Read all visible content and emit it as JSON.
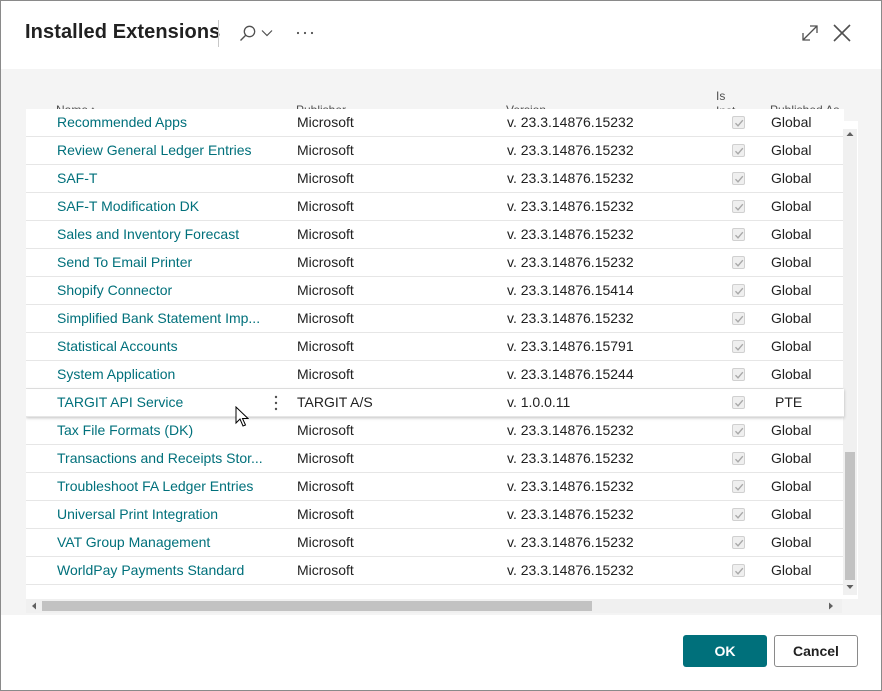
{
  "dialog": {
    "title": "Installed Extensions",
    "ok_label": "OK",
    "cancel_label": "Cancel"
  },
  "columns": {
    "name": "Name",
    "name_sort": "↑",
    "publisher": "Publisher",
    "version": "Version",
    "is_installed_line1": "Is",
    "is_installed_line2": "Inst...",
    "published_as": "Published As"
  },
  "rows": [
    {
      "name": "Recommended Apps",
      "publisher": "Microsoft",
      "version": "v. 23.3.14876.15232",
      "installed": true,
      "published_as": "Global"
    },
    {
      "name": "Review General Ledger Entries",
      "publisher": "Microsoft",
      "version": "v. 23.3.14876.15232",
      "installed": true,
      "published_as": "Global"
    },
    {
      "name": "SAF-T",
      "publisher": "Microsoft",
      "version": "v. 23.3.14876.15232",
      "installed": true,
      "published_as": "Global"
    },
    {
      "name": "SAF-T Modification DK",
      "publisher": "Microsoft",
      "version": "v. 23.3.14876.15232",
      "installed": true,
      "published_as": "Global"
    },
    {
      "name": "Sales and Inventory Forecast",
      "publisher": "Microsoft",
      "version": "v. 23.3.14876.15232",
      "installed": true,
      "published_as": "Global"
    },
    {
      "name": "Send To Email Printer",
      "publisher": "Microsoft",
      "version": "v. 23.3.14876.15232",
      "installed": true,
      "published_as": "Global"
    },
    {
      "name": "Shopify Connector",
      "publisher": "Microsoft",
      "version": "v. 23.3.14876.15414",
      "installed": true,
      "published_as": "Global"
    },
    {
      "name": "Simplified Bank Statement Imp...",
      "publisher": "Microsoft",
      "version": "v. 23.3.14876.15232",
      "installed": true,
      "published_as": "Global"
    },
    {
      "name": "Statistical Accounts",
      "publisher": "Microsoft",
      "version": "v. 23.3.14876.15791",
      "installed": true,
      "published_as": "Global"
    },
    {
      "name": "System Application",
      "publisher": "Microsoft",
      "version": "v. 23.3.14876.15244",
      "installed": true,
      "published_as": "Global"
    },
    {
      "name": "TARGIT API Service",
      "publisher": "TARGIT A/S",
      "version": "v. 1.0.0.11",
      "installed": true,
      "published_as": "PTE",
      "selected": true
    },
    {
      "name": "Tax File Formats (DK)",
      "publisher": "Microsoft",
      "version": "v. 23.3.14876.15232",
      "installed": true,
      "published_as": "Global"
    },
    {
      "name": "Transactions and Receipts Stor...",
      "publisher": "Microsoft",
      "version": "v. 23.3.14876.15232",
      "installed": true,
      "published_as": "Global"
    },
    {
      "name": "Troubleshoot FA Ledger Entries",
      "publisher": "Microsoft",
      "version": "v. 23.3.14876.15232",
      "installed": true,
      "published_as": "Global"
    },
    {
      "name": "Universal Print Integration",
      "publisher": "Microsoft",
      "version": "v. 23.3.14876.15232",
      "installed": true,
      "published_as": "Global"
    },
    {
      "name": "VAT Group Management",
      "publisher": "Microsoft",
      "version": "v. 23.3.14876.15232",
      "installed": true,
      "published_as": "Global"
    },
    {
      "name": "WorldPay Payments Standard",
      "publisher": "Microsoft",
      "version": "v. 23.3.14876.15232",
      "installed": true,
      "published_as": "Global"
    }
  ],
  "icons": {
    "search": "search-icon",
    "more": "more-horizontal-icon",
    "expand": "expand-icon",
    "close": "close-icon",
    "row_menu": "more-vertical-icon"
  },
  "colors": {
    "accent": "#00707b",
    "link": "#00707b"
  }
}
